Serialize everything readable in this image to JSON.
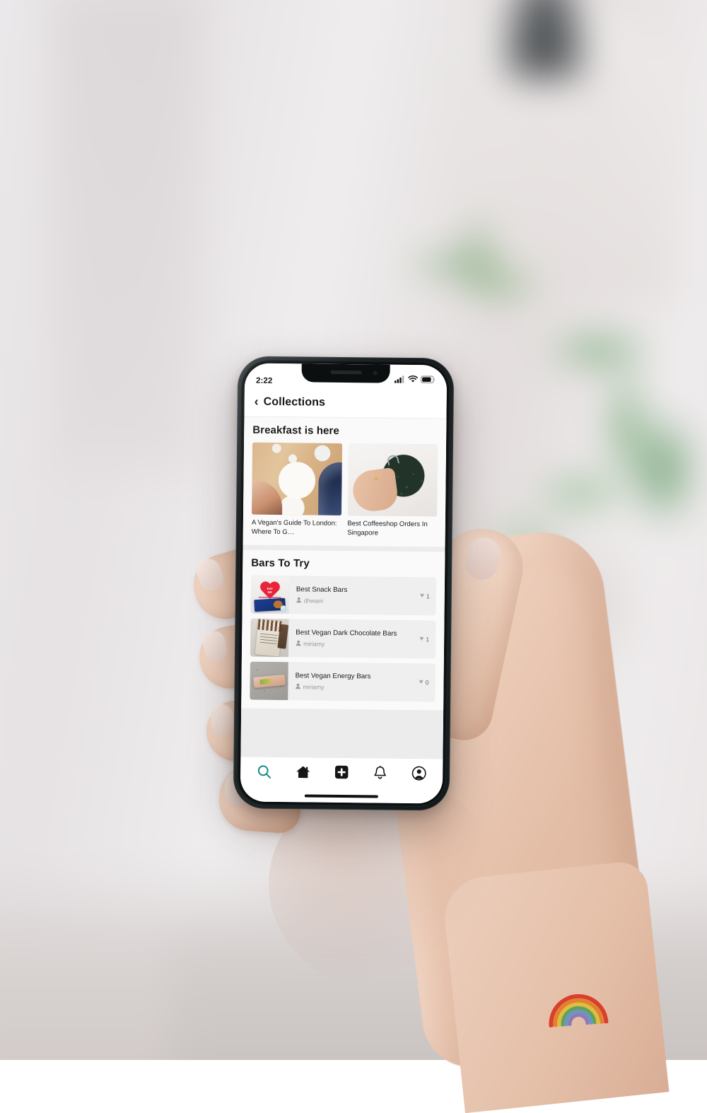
{
  "scene": {
    "description": "hand-holding-phone",
    "background_colors": {
      "wall": "#e9e4e6",
      "plant_green": "#4e8c4a",
      "floor": "#cfc8c6"
    },
    "skin_tone": "#e8c4ae",
    "tattoo": {
      "name": "rainbow-tattoo",
      "colors": [
        "#e0402a",
        "#e8832a",
        "#e8c33a",
        "#5ca85a",
        "#5a8fc4",
        "#8a6fb0"
      ]
    }
  },
  "phone": {
    "frame_color": "#151a1c",
    "status_bar": {
      "time": "2:22",
      "signal_icon": "cellular-signal-icon",
      "wifi_icon": "wifi-icon",
      "battery_icon": "battery-icon"
    },
    "home_indicator": "home-indicator"
  },
  "app": {
    "navbar": {
      "back_icon": "‹",
      "title": "Collections"
    },
    "sections": [
      {
        "title": "Breakfast is here",
        "layout": "cards",
        "cards": [
          {
            "title": "A Vegan's Guide To London: Where To G…",
            "image": "vegan-bowls-flatlay"
          },
          {
            "title": "Best Coffeeshop Orders In Singapore",
            "image": "green-smoothie-in-hand"
          }
        ]
      },
      {
        "title": "Bars To Try",
        "layout": "rows",
        "rows": [
          {
            "title": "Best Snack Bars",
            "author": "dhwani",
            "likes": "1",
            "image": "eat-me-snack-bar"
          },
          {
            "title": "Best Vegan Dark Chocolate Bars",
            "author": "miriamy",
            "likes": "1",
            "image": "dark-chocolate-bar"
          },
          {
            "title": "Best Vegan Energy Bars",
            "author": "miriamy",
            "likes": "0",
            "image": "energy-bar-on-concrete"
          }
        ]
      }
    ],
    "tabbar": {
      "active_color": "#1a8a87",
      "inactive_color": "#161616",
      "tabs": [
        {
          "name": "search-tab",
          "icon": "search-icon",
          "active": true
        },
        {
          "name": "home-tab",
          "icon": "home-icon",
          "active": false
        },
        {
          "name": "create-tab",
          "icon": "plus-square-icon",
          "active": false
        },
        {
          "name": "notifications-tab",
          "icon": "bell-icon",
          "active": false
        },
        {
          "name": "profile-tab",
          "icon": "person-icon",
          "active": false
        }
      ]
    },
    "icons": {
      "person_glyph": "👤",
      "heart_glyph": "♥"
    }
  }
}
